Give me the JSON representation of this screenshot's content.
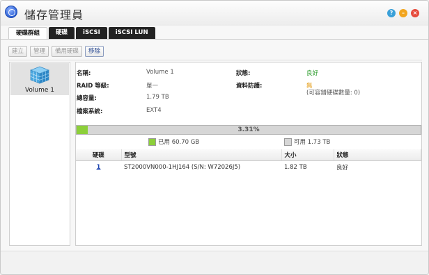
{
  "window": {
    "title": "儲存管理員"
  },
  "tabs": [
    {
      "label": "硬碟群組",
      "active": true
    },
    {
      "label": "硬碟",
      "active": false
    },
    {
      "label": "iSCSI",
      "active": false
    },
    {
      "label": "iSCSI LUN",
      "active": false
    }
  ],
  "toolbar": {
    "create": "建立",
    "manage": "管理",
    "spare": "備用硬碟",
    "remove": "移除"
  },
  "volumes": [
    {
      "label": "Volume 1"
    }
  ],
  "details": {
    "name_label": "名稱:",
    "name_value": "Volume 1",
    "raid_label": "RAID 等級:",
    "raid_value": "單一",
    "capacity_label": "總容量:",
    "capacity_value": "1.79 TB",
    "fs_label": "檔案系統:",
    "fs_value": "EXT4",
    "status_label": "狀態:",
    "status_value": "良好",
    "protect_label": "資料防護:",
    "protect_value": "無",
    "protect_note": "(可容錯硬碟數量: 0)"
  },
  "usage": {
    "percent_text": "3.31%",
    "fraction": 0.0331,
    "used_label": "已用 60.70 GB",
    "free_label": "可用 1.73 TB",
    "used_color": "#8ccf3a",
    "free_color": "#d6d6d6"
  },
  "disk_table": {
    "headers": [
      "硬碟",
      "型號",
      "大小",
      "狀態"
    ],
    "rows": [
      {
        "disk": "1",
        "model": "ST2000VN000-1HJ164 (S/N: W72026J5)",
        "size": "1.82 TB",
        "status": "良好"
      }
    ]
  }
}
